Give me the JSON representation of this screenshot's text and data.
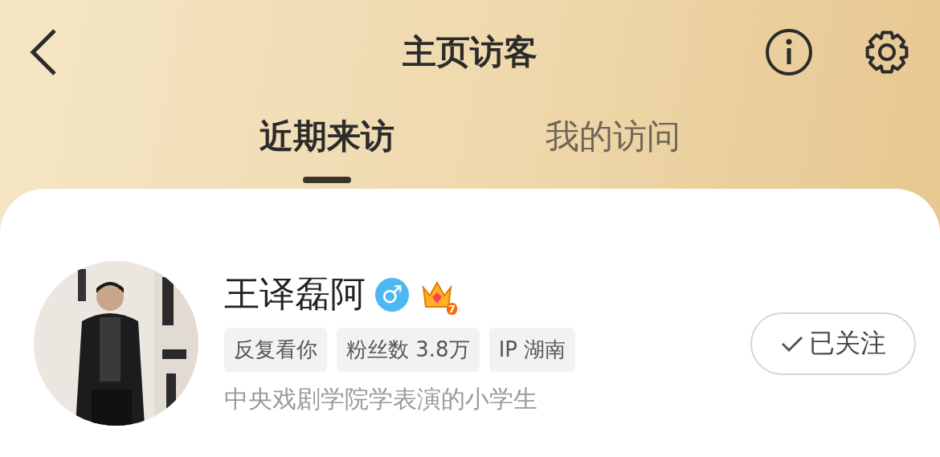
{
  "header": {
    "title": "主页访客"
  },
  "tabs": [
    {
      "label": "近期来访",
      "selected": true
    },
    {
      "label": "我的访问",
      "selected": false
    }
  ],
  "visitors": [
    {
      "name": "王译磊阿",
      "gender_symbol": "♂",
      "vip_level": "7",
      "tags": [
        "反复看你",
        "粉丝数 3.8万",
        "IP 湖南"
      ],
      "bio": "中央戏剧学院学表演的小学生",
      "follow_label": "已关注",
      "followed": true
    }
  ]
}
